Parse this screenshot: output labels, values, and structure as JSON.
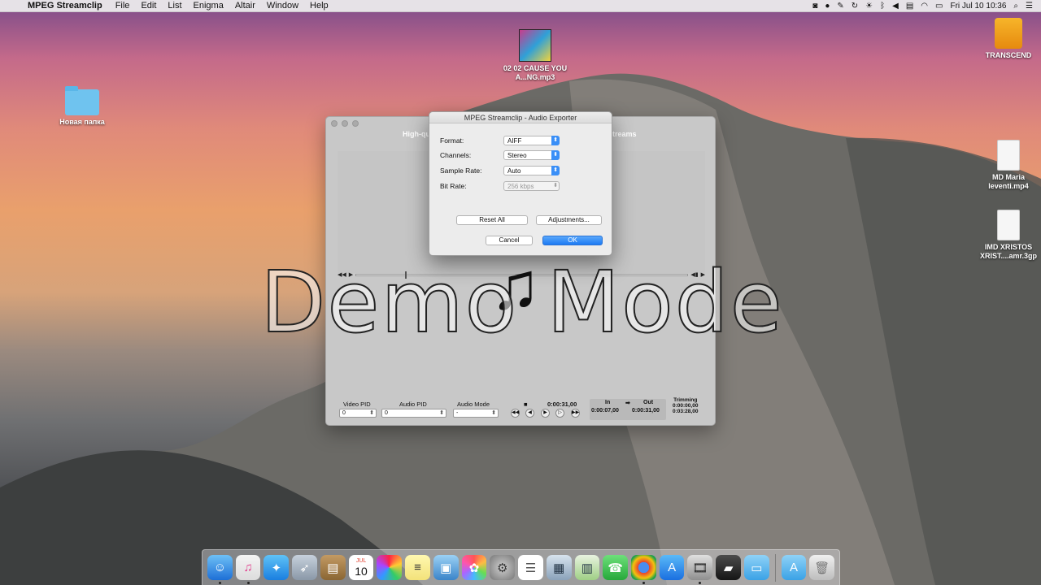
{
  "menubar": {
    "app_name": "MPEG Streamclip",
    "menus": [
      "File",
      "Edit",
      "List",
      "Enigma",
      "Altair",
      "Window",
      "Help"
    ],
    "clock": "Fri Jul 10  10:36"
  },
  "desktop": {
    "folder_label": "Новая папка",
    "album_label": "02 02 CAUSE YOU A...NG.mp3",
    "drive_label": "TRANSCEND",
    "video1_label": "MD Maria leventi.mp4",
    "video2_label": "IMD XRISTOS XRIST....amr.3gp"
  },
  "main_window": {
    "banner_left": "High-qu",
    "banner_right": "treams",
    "video_pid_label": "Video PID",
    "video_pid_value": "0",
    "audio_pid_label": "Audio PID",
    "audio_pid_value": "0",
    "audio_mode_label": "Audio Mode",
    "audio_mode_value": "-",
    "time_current": "0:00:31,00",
    "in_label": "In",
    "in_value": "0:00:07,00",
    "out_label": "Out",
    "out_value": "0:00:31,00",
    "trimming_label": "Trimming",
    "trimming_value1": "0:00:00,00",
    "trimming_value2": "0:03:28,00"
  },
  "dialog": {
    "title": "MPEG Streamclip - Audio Exporter",
    "format_label": "Format:",
    "format_value": "AIFF",
    "channels_label": "Channels:",
    "channels_value": "Stereo",
    "sample_rate_label": "Sample Rate:",
    "sample_rate_value": "Auto",
    "bit_rate_label": "Bit Rate:",
    "bit_rate_value": "256 kbps",
    "reset_label": "Reset All",
    "adjust_label": "Adjustments...",
    "cancel_label": "Cancel",
    "ok_label": "OK"
  },
  "overlay": {
    "demo_text": "Demo Mode",
    "note_glyph": "♫"
  },
  "dock": {
    "calendar_month": "JUL",
    "calendar_day": "10"
  }
}
